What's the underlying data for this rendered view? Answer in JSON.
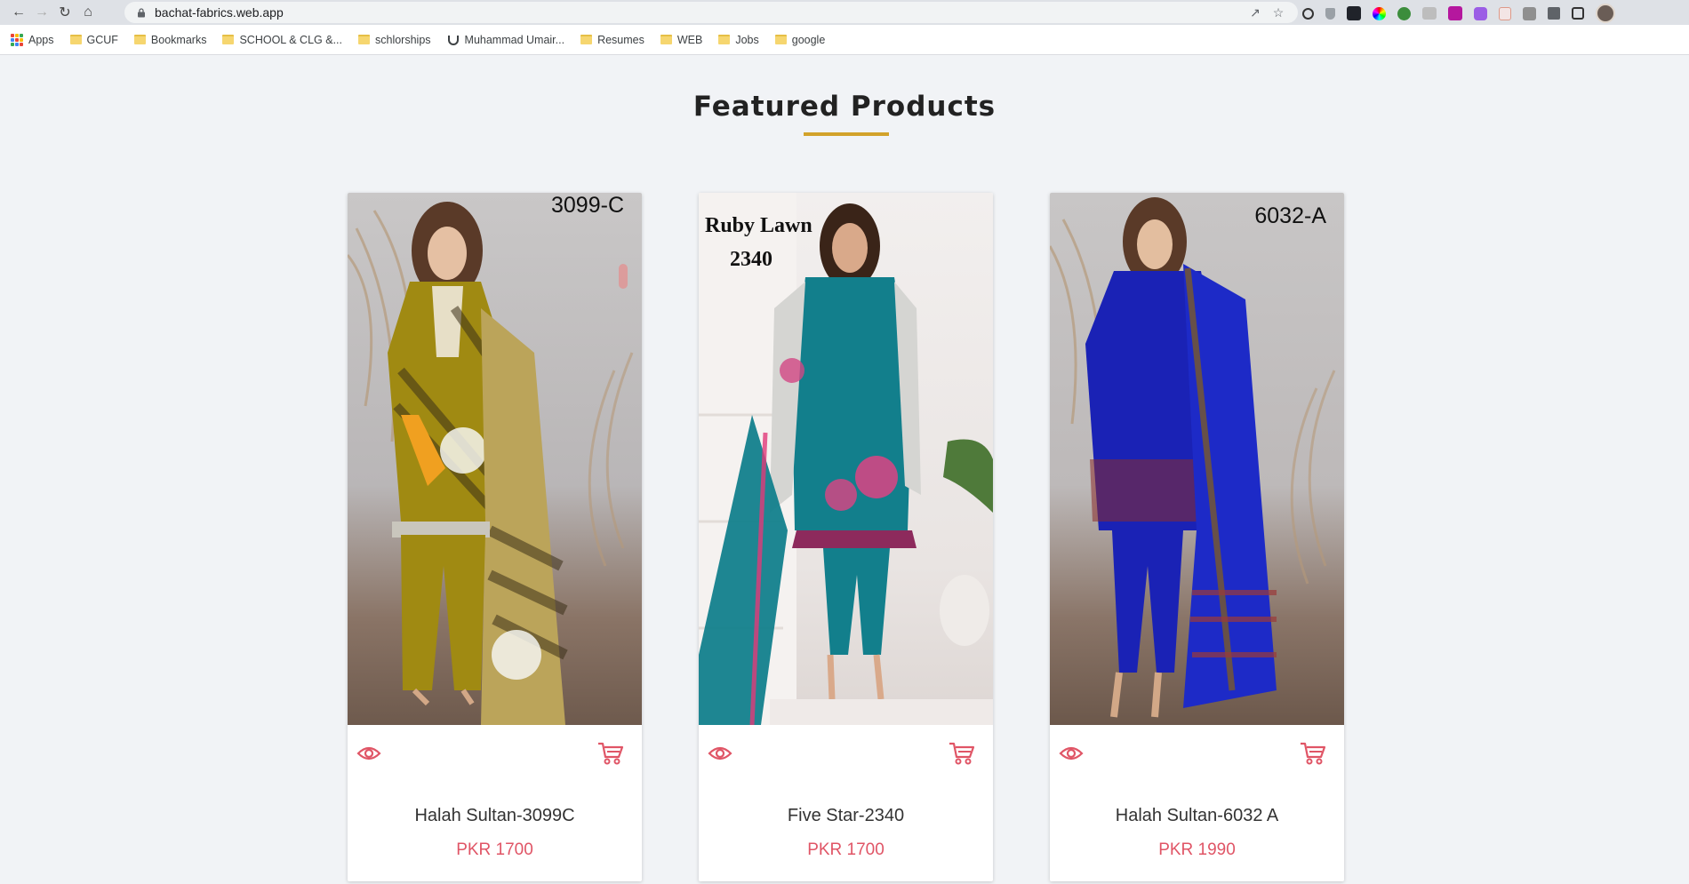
{
  "browser": {
    "url": "bachat-fabrics.web.app",
    "bookmarks": [
      {
        "label": "Apps",
        "icon": "apps-grid-icon"
      },
      {
        "label": "GCUF",
        "icon": "folder-icon"
      },
      {
        "label": "Bookmarks",
        "icon": "folder-icon"
      },
      {
        "label": "SCHOOL & CLG &...",
        "icon": "folder-icon"
      },
      {
        "label": "schlorships",
        "icon": "folder-icon"
      },
      {
        "label": "Muhammad Umair...",
        "icon": "upwork-icon"
      },
      {
        "label": "Resumes",
        "icon": "folder-icon"
      },
      {
        "label": "WEB",
        "icon": "folder-icon"
      },
      {
        "label": "Jobs",
        "icon": "folder-icon"
      },
      {
        "label": "google",
        "icon": "folder-icon"
      }
    ]
  },
  "page": {
    "section_title": "Featured Products",
    "accent_color": "#d2a22a",
    "price_color": "#e05566"
  },
  "products": [
    {
      "name": "Halah Sultan-3099C",
      "price": "PKR 1700",
      "photo_label": "3099-C",
      "dress_color": "#a08a12"
    },
    {
      "name": "Five Star-2340",
      "price": "PKR 1700",
      "photo_label_line1": "Ruby Lawn",
      "photo_label_line2": "2340",
      "dress_color": "#127f8c"
    },
    {
      "name": "Halah Sultan-6032 A",
      "price": "PKR 1990",
      "photo_label": "6032-A",
      "dress_color": "#1a22b5"
    }
  ]
}
